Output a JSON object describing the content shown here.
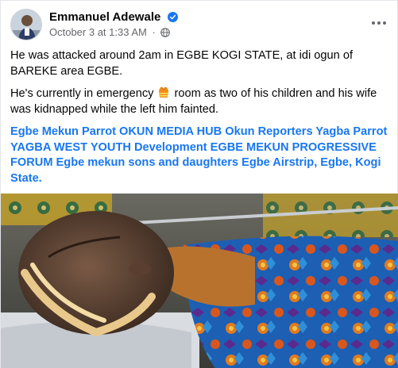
{
  "author": {
    "name": "Emmanuel Adewale",
    "timestamp": "October 3 at 1:33 AM",
    "separator": "·",
    "verified": true
  },
  "icons": {
    "verified": "verified-badge-icon",
    "privacy": "globe-icon",
    "more": "more-options-icon",
    "emoji": "safety-vest-emoji"
  },
  "post": {
    "para1": "He was attacked around 2am in EGBE KOGI STATE, at idi ogun of BAREKE area EGBE.",
    "para2_before": "He's currently in emergency",
    "para2_after": "room as two of his children and his wife was kidnapped while the left him fainted.",
    "tags": "Egbe Mekun Parrot OKUN MEDIA HUB Okun Reporters Yagba  Parrot YAGBA WEST YOUTH Development EGBE MEKUN PROGRESSIVE FORUM Egbe mekun sons and daughters Egbe Airstrip, Egbe, Kogi State."
  },
  "colors": {
    "link": "#1877f2",
    "meta": "#65676b",
    "verified": "#1877f2"
  }
}
